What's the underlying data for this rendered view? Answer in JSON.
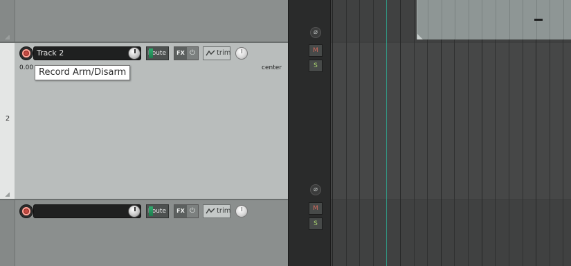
{
  "track2": {
    "number": "2",
    "name": "Track 2",
    "volume_readout": "0.00",
    "pan_readout": "center",
    "route_label": "Route",
    "fx_label": "FX",
    "fx_bypass_glyph": "⏻",
    "trim_label": "trim",
    "tooltip": "Record Arm/Disarm"
  },
  "track3": {
    "name": "",
    "route_label": "Route",
    "fx_label": "FX",
    "fx_bypass_glyph": "⏻",
    "trim_label": "trim"
  },
  "mixer": {
    "phase_glyph": "⌀",
    "mute_label": "M",
    "solo_label": "S"
  },
  "colors": {
    "record_arm": "#c44a42",
    "playhead": "#2bb59a",
    "selected_track_bg": "#b9bdbc",
    "route_meter": "#2fae6f"
  },
  "icons": {
    "record": "record-arm-icon",
    "phase": "phase-invert-icon",
    "power": "fx-bypass-icon",
    "envelope": "trim-envelope-icon"
  }
}
